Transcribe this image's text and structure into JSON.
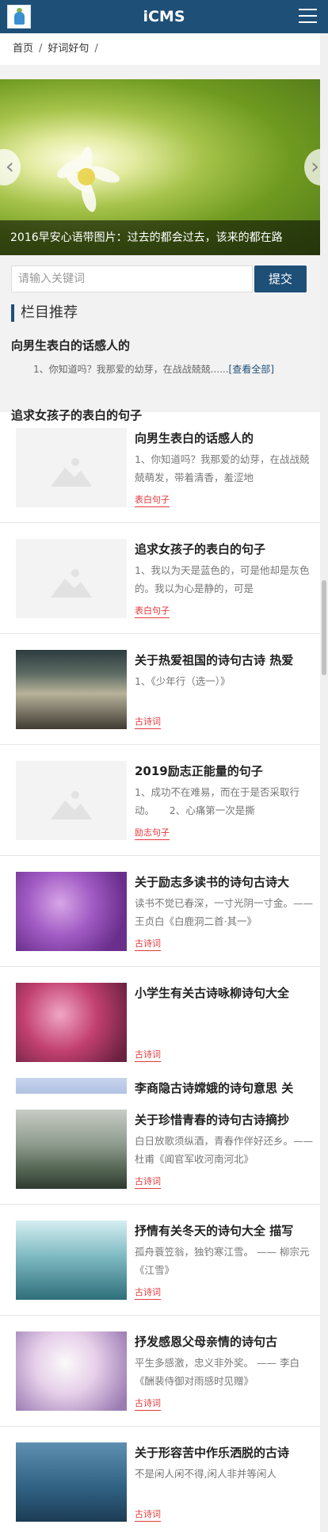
{
  "header": {
    "title": "iCMS",
    "logo_icon": "logo-icon",
    "menu_icon": "menu-icon"
  },
  "breadcrumb": {
    "home": "首页",
    "category": "好词好句",
    "sep": "/"
  },
  "slider": {
    "caption": "2016早安心语带图片：过去的都会过去，该来的都在路",
    "prev": "‹",
    "next": "›"
  },
  "search": {
    "placeholder": "请输入关键词",
    "submit_label": "提交"
  },
  "section": {
    "title": "栏目推荐"
  },
  "featured": {
    "title": "向男生表白的话感人的",
    "desc": "1、你知道吗？我那爱的幼芽，在战战兢兢......",
    "more": "[查看全部]",
    "title2": "追求女孩子的表白的句子"
  },
  "articles": [
    {
      "title": "向男生表白的话感人的",
      "desc": "1、你知道吗？我那爱的幼芽，在战战兢兢萌发，带着清香，羞涩地",
      "tag": "表白句子",
      "thumb": "placeholder"
    },
    {
      "title": "追求女孩子的表白的句子",
      "desc": "1、我以为天是蓝色的，可是他却是灰色的。我以为心是静的，可是",
      "tag": "表白句子",
      "thumb": "placeholder"
    },
    {
      "title": "关于热爱祖国的诗句古诗 热爱",
      "desc": "1、《少年行（选一）》",
      "tag": "古诗词",
      "thumb": "classroom"
    },
    {
      "title": "2019励志正能量的句子",
      "desc": "1、成功不在难易，而在于是否采取行动。　　2、心痛第一次是撕",
      "tag": "励志句子",
      "thumb": "placeholder"
    },
    {
      "title": "关于励志多读书的诗句古诗大",
      "desc": "读书不觉已春深，一寸光阴一寸金。—— 王贞白《白鹿洞二首·其一》",
      "tag": "古诗词",
      "thumb": "purple-flowers"
    },
    {
      "title": "小学生有关古诗咏柳诗句大全",
      "desc": "",
      "tag": "古诗词",
      "thumb": "pink-flowers"
    },
    {
      "title": "李商隐古诗嫦娥的诗句意思 关",
      "desc": "",
      "tag": "",
      "thumb": "bike"
    },
    {
      "title": "关于珍惜青春的诗句古诗摘抄",
      "desc": "白日放歌须纵酒，青春作伴好还乡。—— 杜甫《闻官军收河南河北》",
      "tag": "古诗词",
      "thumb": "train"
    },
    {
      "title": "抒情有关冬天的诗句大全 描写",
      "desc": "孤舟蓑笠翁，独钓寒江雪。 —— 柳宗元《江雪》",
      "tag": "古诗词",
      "thumb": "hourglass"
    },
    {
      "title": "抒发感恩父母亲情的诗句古",
      "desc": "平生多感激，忠义非外奖。 —— 李白《酬裴侍御对雨感时见赠》",
      "tag": "古诗词",
      "thumb": "white-flowers"
    },
    {
      "title": "关于形容苦中作乐洒脱的古诗",
      "desc": "不是闲人闲不得,闲人非并等闲人",
      "tag": "古诗词",
      "thumb": "paper-boats"
    }
  ],
  "colors": {
    "primary": "#1e4f77",
    "tag": "#e4393c"
  }
}
